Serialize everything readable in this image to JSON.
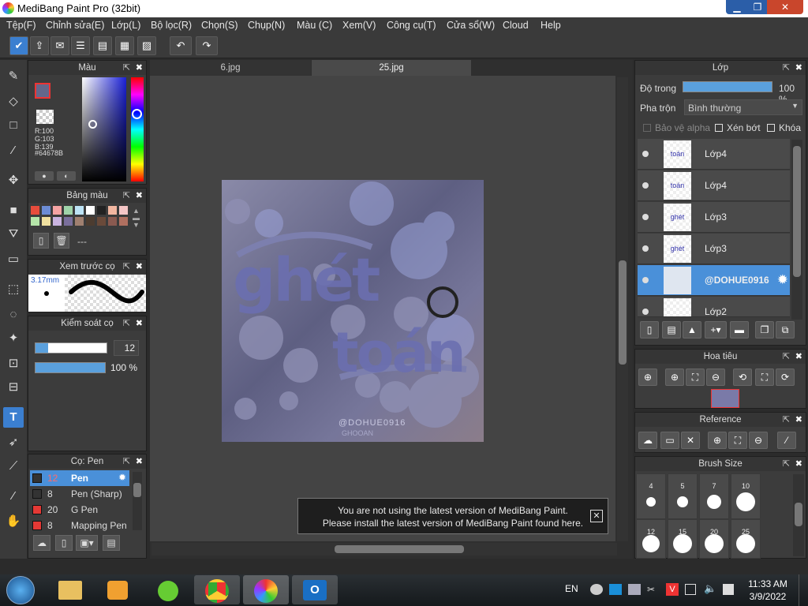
{
  "window": {
    "title": "MediBang Paint Pro (32bit)",
    "minimize": "▁",
    "restore": "❐",
    "close": "✕"
  },
  "menu": [
    "Tệp(F)",
    "Chỉnh sửa(E)",
    "Lớp(L)",
    "Bộ lọc(R)",
    "Chọn(S)",
    "Chụp(N)",
    "Màu (C)",
    "Xem(V)",
    "Công cụ(T)",
    "Cửa sổ(W)",
    "Cloud",
    "Help"
  ],
  "color_panel": {
    "title": "Màu",
    "r": "R:100",
    "g": "G:103",
    "b": "B:139",
    "hex": "#64678B",
    "primary_color": "#64678B"
  },
  "palette_panel": {
    "title": "Bảng màu",
    "name": "---",
    "swatches": [
      "#e74c3c",
      "#6c8cd5",
      "#f5a3a3",
      "#9fd3a9",
      "#bde3f5",
      "#ffffff",
      "#222222",
      "#f2b6a0",
      "#f5c6c6",
      "#b5e5a9",
      "#f0e0a0",
      "#c9b3e0",
      "#7a6f9c",
      "#a08070",
      "#4c3c30",
      "#6a4a3a",
      "#8a5a50",
      "#b07060"
    ]
  },
  "preview_panel": {
    "title": "Xem trước cọ",
    "size": "3.17mm"
  },
  "control_panel": {
    "title": "Kiểm soát cọ",
    "size_value": "12",
    "opacity_value": "100 %",
    "size_fraction": 0.18,
    "opacity_fraction": 1.0
  },
  "brush_panel": {
    "title": "Cọ: Pen",
    "brushes": [
      {
        "size": "12",
        "name": "Pen",
        "color": "#333333",
        "selected": true
      },
      {
        "size": "8",
        "name": "Pen (Sharp)",
        "color": "#333333",
        "selected": false
      },
      {
        "size": "20",
        "name": "G Pen",
        "color": "#e53935",
        "selected": false
      },
      {
        "size": "8",
        "name": "Mapping Pen",
        "color": "#e53935",
        "selected": false
      }
    ]
  },
  "tabs": [
    "6.jpg",
    "25.jpg"
  ],
  "artwork": {
    "text_main_1": "ghét",
    "text_main_2": "toán",
    "watermark_1": "@DOHUE0916",
    "watermark_2": "GHOOAN"
  },
  "notification": {
    "line1": "You are not using the latest version of MediBang Paint.",
    "line2": "Please install the latest version of MediBang Paint found here.",
    "close": "✕"
  },
  "layer_panel": {
    "title": "Lớp",
    "opacity_label": "Độ trong",
    "opacity_value": "100 %",
    "blend_label": "Pha trộn",
    "blend_value": "Bình thường",
    "protect_alpha": "Bảo vệ alpha",
    "clip": "Xén bớt",
    "lock": "Khóa",
    "layers": [
      {
        "name": "Lớp4",
        "thumb": "toán",
        "selected": false
      },
      {
        "name": "Lớp4",
        "thumb": "toán",
        "selected": false
      },
      {
        "name": "Lớp3",
        "thumb": "ghét",
        "selected": false
      },
      {
        "name": "Lớp3",
        "thumb": "ghét",
        "selected": false
      },
      {
        "name": "@DOHUE0916",
        "thumb": "",
        "selected": true
      },
      {
        "name": "Lớp2",
        "thumb": "",
        "selected": false
      }
    ]
  },
  "navigator_panel": {
    "title": "Hoa tiêu"
  },
  "reference_panel": {
    "title": "Reference"
  },
  "brush_size_panel": {
    "title": "Brush Size",
    "sizes": [
      "4",
      "5",
      "7",
      "10",
      "12",
      "15",
      "20",
      "25"
    ]
  },
  "taskbar": {
    "lang": "EN",
    "time": "11:33 AM",
    "date": "3/9/2022"
  },
  "colors": {
    "accent": "#5aa0dd",
    "selected_row": "#4a90d9",
    "panel": "#3c3c3c"
  }
}
